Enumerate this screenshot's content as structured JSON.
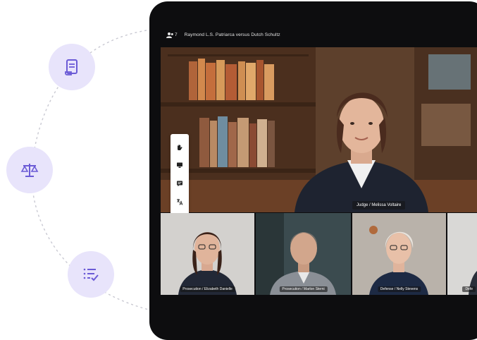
{
  "meeting": {
    "participant_count": "7",
    "title": "Raymond L.S. Patriarca versus Dutch Schultz"
  },
  "main_speaker": {
    "label": "Judge / Melissa Voltaire"
  },
  "thumbnails": [
    {
      "label": "Prosecution / Elizabeth Danielle"
    },
    {
      "label": "Prosecution / Marlon Sterni"
    },
    {
      "label": "Defense / Nelly Stevens"
    },
    {
      "label": "Defe"
    }
  ],
  "toolbar": {
    "icons": [
      "hand-icon",
      "screen-share-icon",
      "chat-icon",
      "translate-icon",
      "more-icon"
    ],
    "more_label": "•••"
  },
  "side_icons": [
    "document-icon",
    "scales-icon",
    "checklist-icon"
  ],
  "colors": {
    "accent": "#6b5bd6",
    "icon_circle": "#e8e4fb",
    "device": "#0d0d0f"
  }
}
